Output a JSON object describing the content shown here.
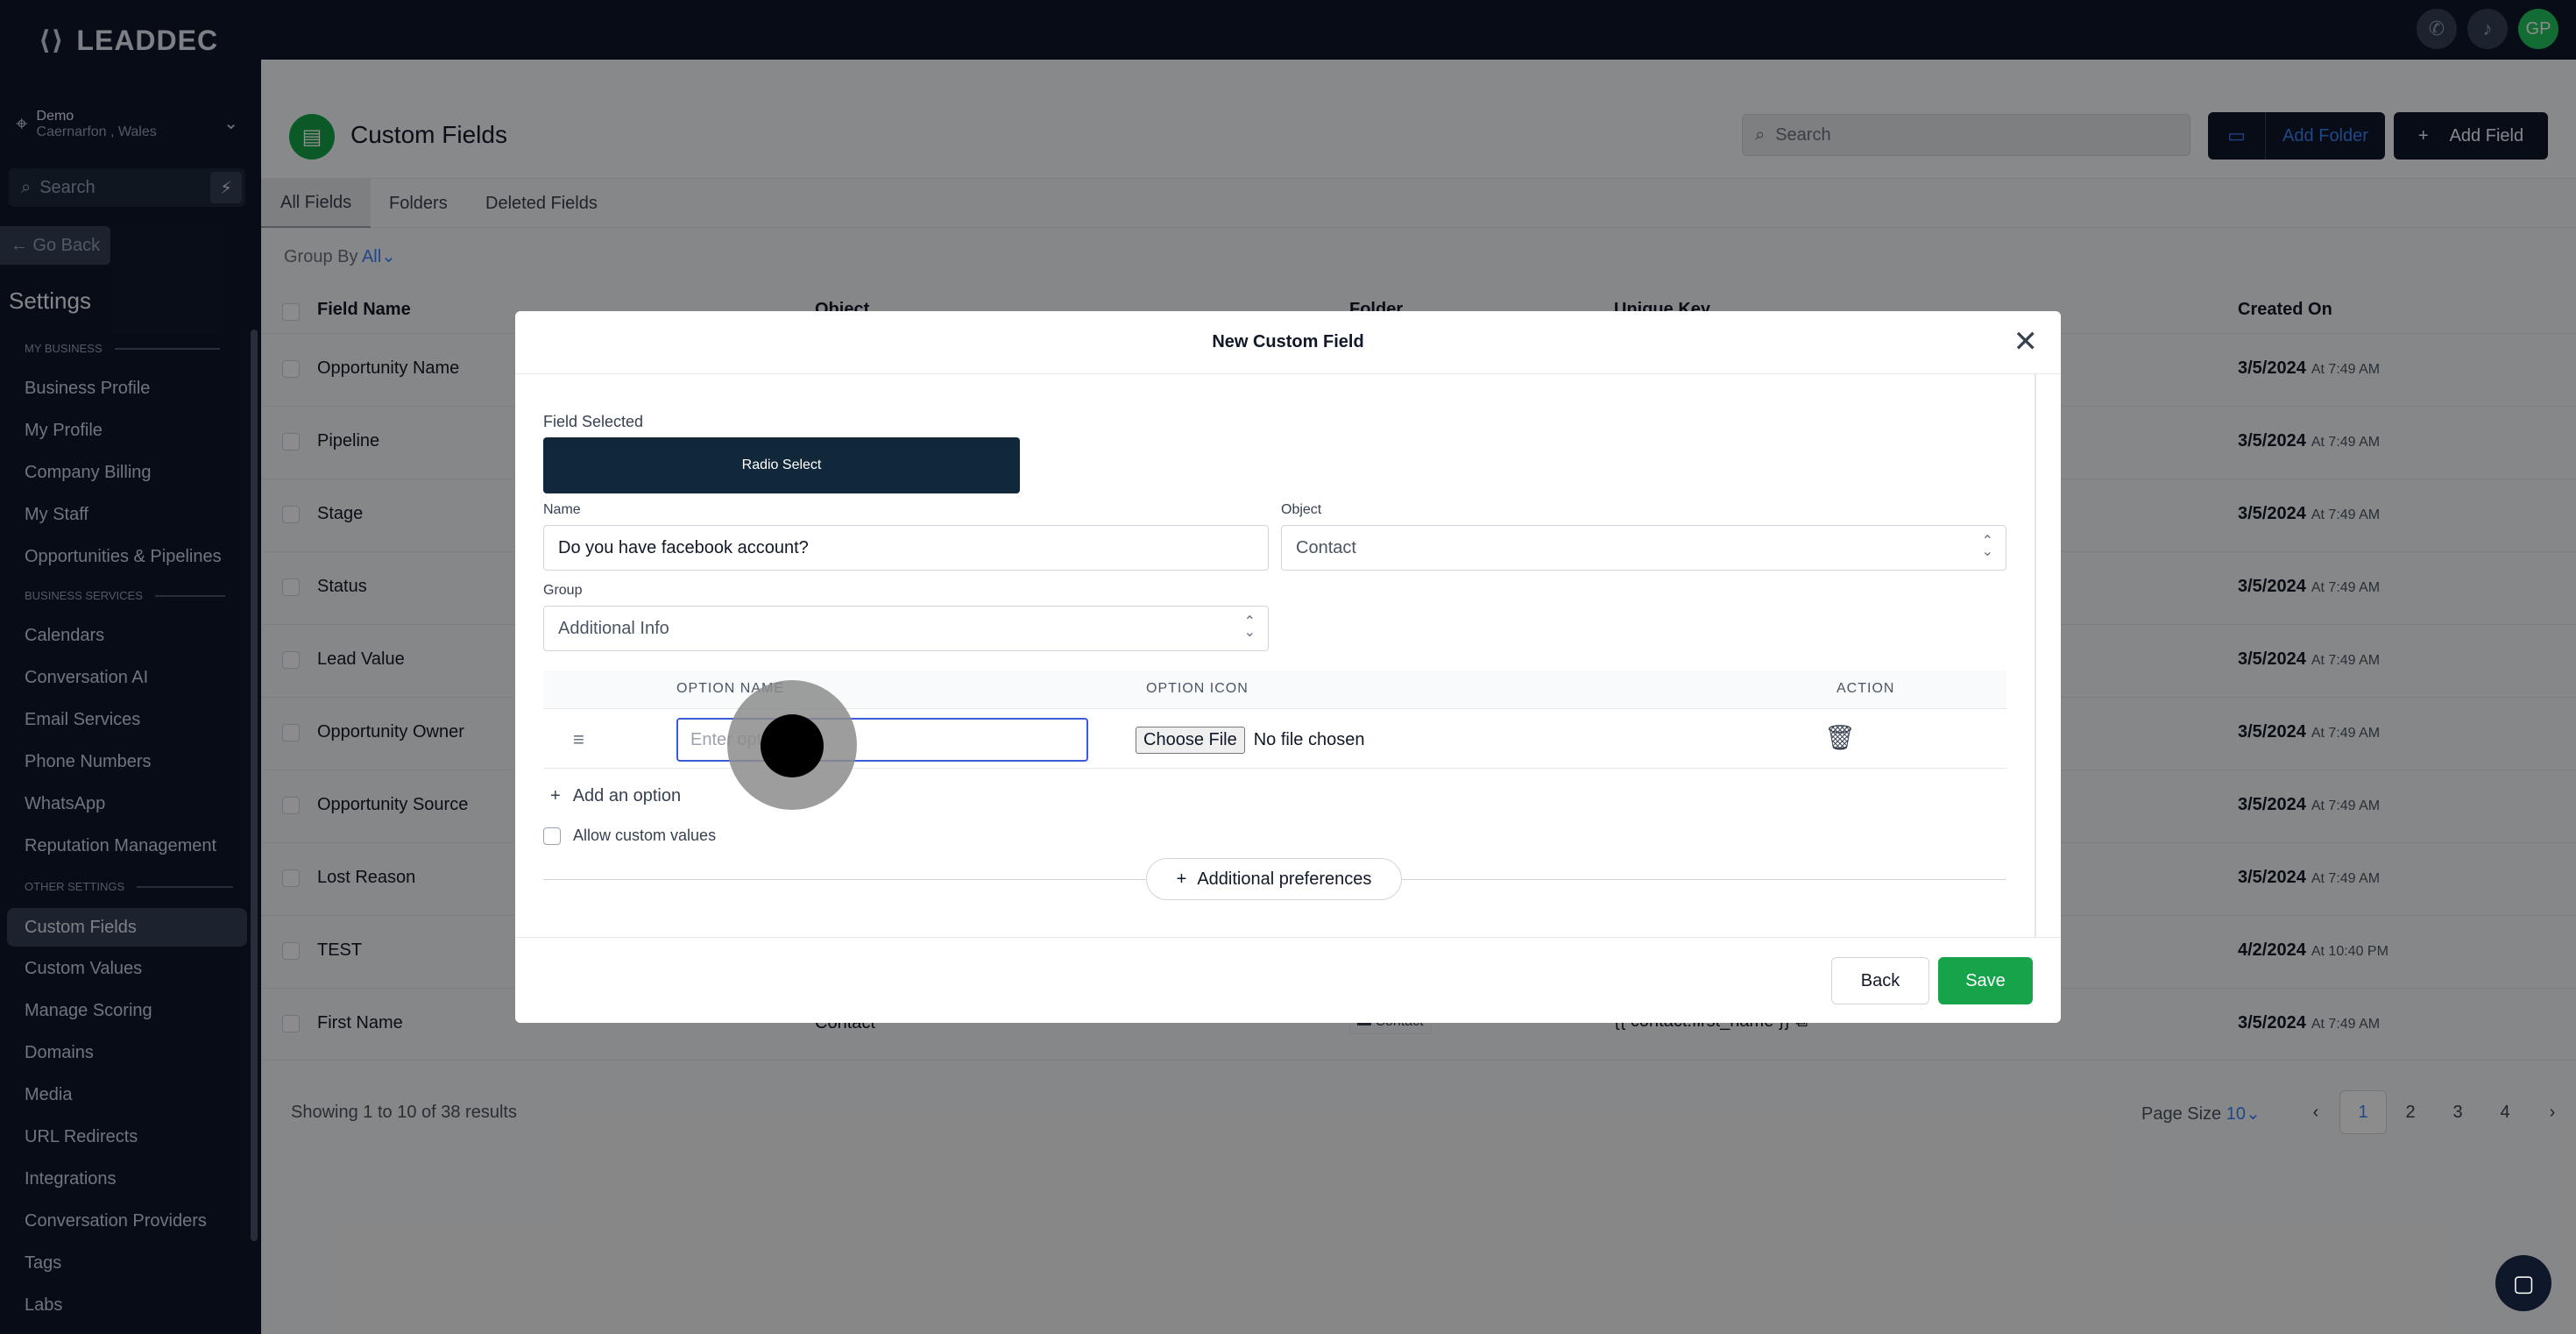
{
  "brand": {
    "name": "LEADDEC"
  },
  "location": {
    "name": "Demo",
    "address": "Caernarfon , Wales"
  },
  "sidebar": {
    "search_placeholder": "Search",
    "go_back": "← Go Back",
    "settings_title": "Settings",
    "sections": [
      {
        "label": "MY BUSINESS",
        "items": [
          "Business Profile",
          "My Profile",
          "Company Billing",
          "My Staff",
          "Opportunities & Pipelines"
        ]
      },
      {
        "label": "BUSINESS SERVICES",
        "items": [
          "Calendars",
          "Conversation AI",
          "Email Services",
          "Phone Numbers",
          "WhatsApp",
          "Reputation Management"
        ]
      },
      {
        "label": "OTHER SETTINGS",
        "items": [
          "Custom Fields",
          "Custom Values",
          "Manage Scoring",
          "Domains",
          "Media",
          "URL Redirects",
          "Integrations",
          "Conversation Providers",
          "Tags",
          "Labs"
        ]
      }
    ]
  },
  "topbar": {
    "avatar_initials": "GP"
  },
  "page": {
    "title": "Custom Fields",
    "search_placeholder": "Search",
    "add_folder": "Add Folder",
    "add_field": "Add Field",
    "tabs": [
      "All Fields",
      "Folders",
      "Deleted Fields"
    ],
    "group_by_label": "Group By",
    "group_by_value": "All",
    "columns": [
      "Field Name",
      "Object",
      "Folder",
      "Unique Key",
      "Created On"
    ],
    "rows": [
      {
        "name": "Opportunity Name",
        "date": "3/5/2024",
        "time": "At 7:49 AM"
      },
      {
        "name": "Pipeline",
        "date": "3/5/2024",
        "time": "At 7:49 AM"
      },
      {
        "name": "Stage",
        "date": "3/5/2024",
        "time": "At 7:49 AM"
      },
      {
        "name": "Status",
        "date": "3/5/2024",
        "time": "At 7:49 AM"
      },
      {
        "name": "Lead Value",
        "date": "3/5/2024",
        "time": "At 7:49 AM"
      },
      {
        "name": "Opportunity Owner",
        "date": "3/5/2024",
        "time": "At 7:49 AM"
      },
      {
        "name": "Opportunity Source",
        "date": "3/5/2024",
        "time": "At 7:49 AM"
      },
      {
        "name": "Lost Reason",
        "date": "3/5/2024",
        "time": "At 7:49 AM"
      },
      {
        "name": "TEST",
        "date": "4/2/2024",
        "time": "At 10:40 PM"
      },
      {
        "name": "First Name",
        "object": "Contact",
        "folder": "Contact",
        "key": "{{ contact.first_name }}",
        "date": "3/5/2024",
        "time": "At 7:49 AM"
      }
    ],
    "showing_text": "Showing 1 to 10 of 38 results",
    "page_size_label": "Page Size",
    "page_size_value": "10",
    "pages": [
      "1",
      "2",
      "3",
      "4"
    ]
  },
  "modal": {
    "title": "New Custom Field",
    "field_selected_label": "Field Selected",
    "field_type": "Radio Select",
    "name_label": "Name",
    "name_value": "Do you have facebook account?",
    "object_label": "Object",
    "object_value": "Contact",
    "group_label": "Group",
    "group_value": "Additional Info",
    "option_name_header": "OPTION NAME",
    "option_icon_header": "OPTION ICON",
    "action_header": "ACTION",
    "option_placeholder": "Enter option",
    "choose_file": "Choose File",
    "no_file": "No file chosen",
    "add_option": "Add an option",
    "allow_custom": "Allow custom values",
    "additional_prefs": "Additional preferences",
    "back": "Back",
    "save": "Save"
  }
}
